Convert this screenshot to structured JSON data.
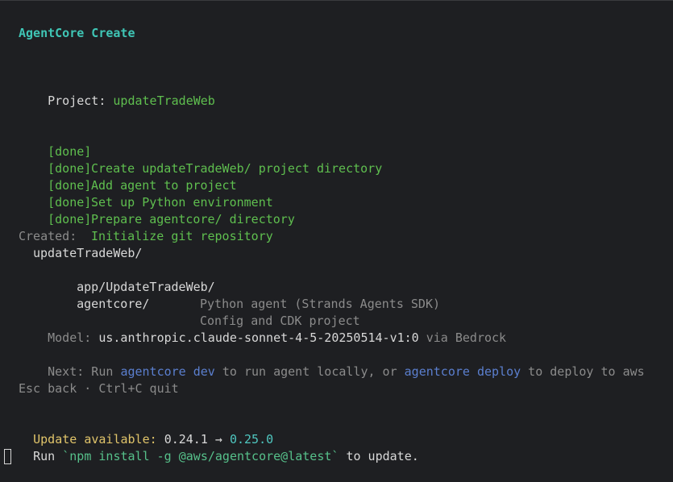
{
  "header": {
    "title": "AgentCore Create"
  },
  "project": {
    "label": "Project: ",
    "name": "updateTradeWeb"
  },
  "steps": [
    {
      "status": "[done]",
      "text": "Create updateTradeWeb/ project directory"
    },
    {
      "status": "[done]",
      "text": "Add agent to project"
    },
    {
      "status": "[done]",
      "text": "Set up Python environment"
    },
    {
      "status": "[done]",
      "text": "Prepare agentcore/ directory"
    },
    {
      "status": "[done]",
      "text": "Initialize git repository"
    }
  ],
  "created": {
    "label": "Created:",
    "root": "updateTradeWeb/",
    "entries": [
      {
        "path": "app/UpdateTradeWeb/",
        "desc": "Python agent (Strands Agents SDK)"
      },
      {
        "path": "agentcore/",
        "desc": "Config and CDK project"
      }
    ]
  },
  "model": {
    "label": "Model: ",
    "id": "us.anthropic.claude-sonnet-4-5-20250514-v1:0",
    "suffix": " via Bedrock"
  },
  "next": {
    "prefix": "Next: Run ",
    "cmd1": "agentcore dev",
    "mid": " to run agent locally, or ",
    "cmd2": "agentcore deploy",
    "suffix": " to deploy to aws"
  },
  "hints": {
    "text": "Esc back · Ctrl+C quit"
  },
  "update": {
    "label": "Update available: ",
    "current": "0.24.1",
    "arrow": " → ",
    "latest": "0.25.0",
    "run_prefix": "Run ",
    "command": "`npm install -g @aws/agentcore@latest`",
    "run_suffix": " to update."
  },
  "colors": {
    "background": "#1e1f22",
    "accent_teal": "#3fc5b5",
    "success_green": "#5fbf4f",
    "command_blue": "#5b7fcf",
    "warning_yellow": "#e0c46a"
  }
}
